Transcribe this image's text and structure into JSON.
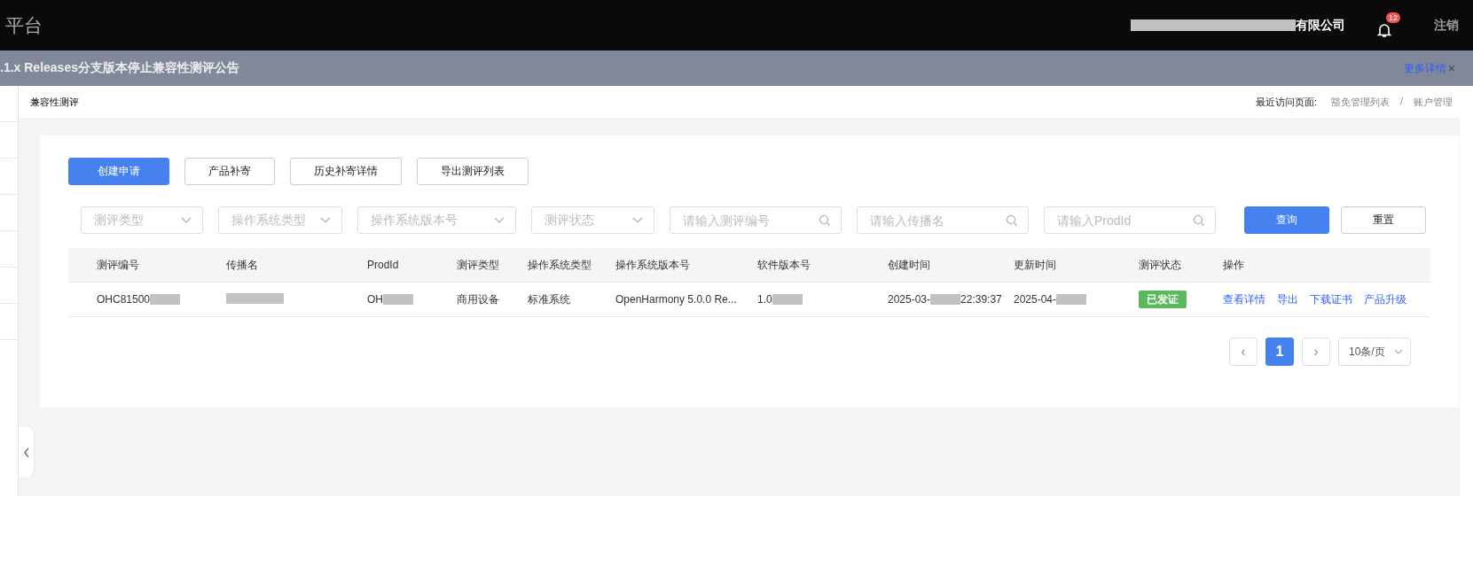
{
  "header": {
    "title": "平台",
    "company": {
      "text": "有限公司",
      "redacted": true
    },
    "notifications": "12",
    "logout": "注销"
  },
  "notice": {
    "text": ".1.x Releases分支版本停止兼容性测评公告",
    "link": "更多详情",
    "close": "×"
  },
  "breadcrumb": {
    "current": "兼容性测评",
    "recent_label": "最近访问页面:",
    "recent": [
      "豁免管理列表",
      "账户管理"
    ],
    "separator": "/"
  },
  "actions": [
    {
      "label": "创建申请",
      "kind": "primary"
    },
    {
      "label": "产品补寄",
      "kind": "default"
    },
    {
      "label": "历史补寄详情",
      "kind": "default"
    },
    {
      "label": "导出测评列表",
      "kind": "default"
    }
  ],
  "filters": [
    {
      "kind": "select",
      "placeholder": "测评类型"
    },
    {
      "kind": "select",
      "placeholder": "操作系统类型"
    },
    {
      "kind": "select",
      "placeholder": "操作系统版本号"
    },
    {
      "kind": "select",
      "placeholder": "测评状态"
    },
    {
      "kind": "search",
      "placeholder": "请输入测评编号"
    },
    {
      "kind": "search",
      "placeholder": "请输入传播名"
    },
    {
      "kind": "search",
      "placeholder": "请输入ProdId"
    }
  ],
  "query_buttons": [
    {
      "label": "查询",
      "kind": "primary"
    },
    {
      "label": "重置",
      "kind": "default"
    }
  ],
  "table": {
    "columns": [
      "测评编号",
      "传播名",
      "ProdId",
      "测评类型",
      "操作系统类型",
      "操作系统版本号",
      "软件版本号",
      "创建时间",
      "更新时间",
      "测评状态",
      "操作"
    ],
    "rows": [
      {
        "cells": [
          {
            "text": "OHC81500",
            "redacted": true
          },
          {
            "redacted": true
          },
          {
            "text": "OH",
            "redacted": true
          },
          {
            "text": "商用设备",
            "redacted": false
          },
          {
            "text": "标准系统",
            "redacted": false
          },
          {
            "text": "OpenHarmony 5.0.0 Re...",
            "redacted": false
          },
          {
            "text": "1.0",
            "redacted": true
          },
          {
            "text": "2025-03-",
            "redacted": true,
            "suffix": "22:39:37"
          },
          {
            "text": "2025-04-",
            "redacted": true
          }
        ],
        "status": "已发证",
        "links": [
          "查看详情",
          "导出",
          "下载证书",
          "产品升级"
        ]
      }
    ]
  },
  "pagination": {
    "prev": "‹",
    "pages": [
      {
        "label": "1",
        "selected": true
      }
    ],
    "next": "›",
    "page_size": "10条/页"
  }
}
